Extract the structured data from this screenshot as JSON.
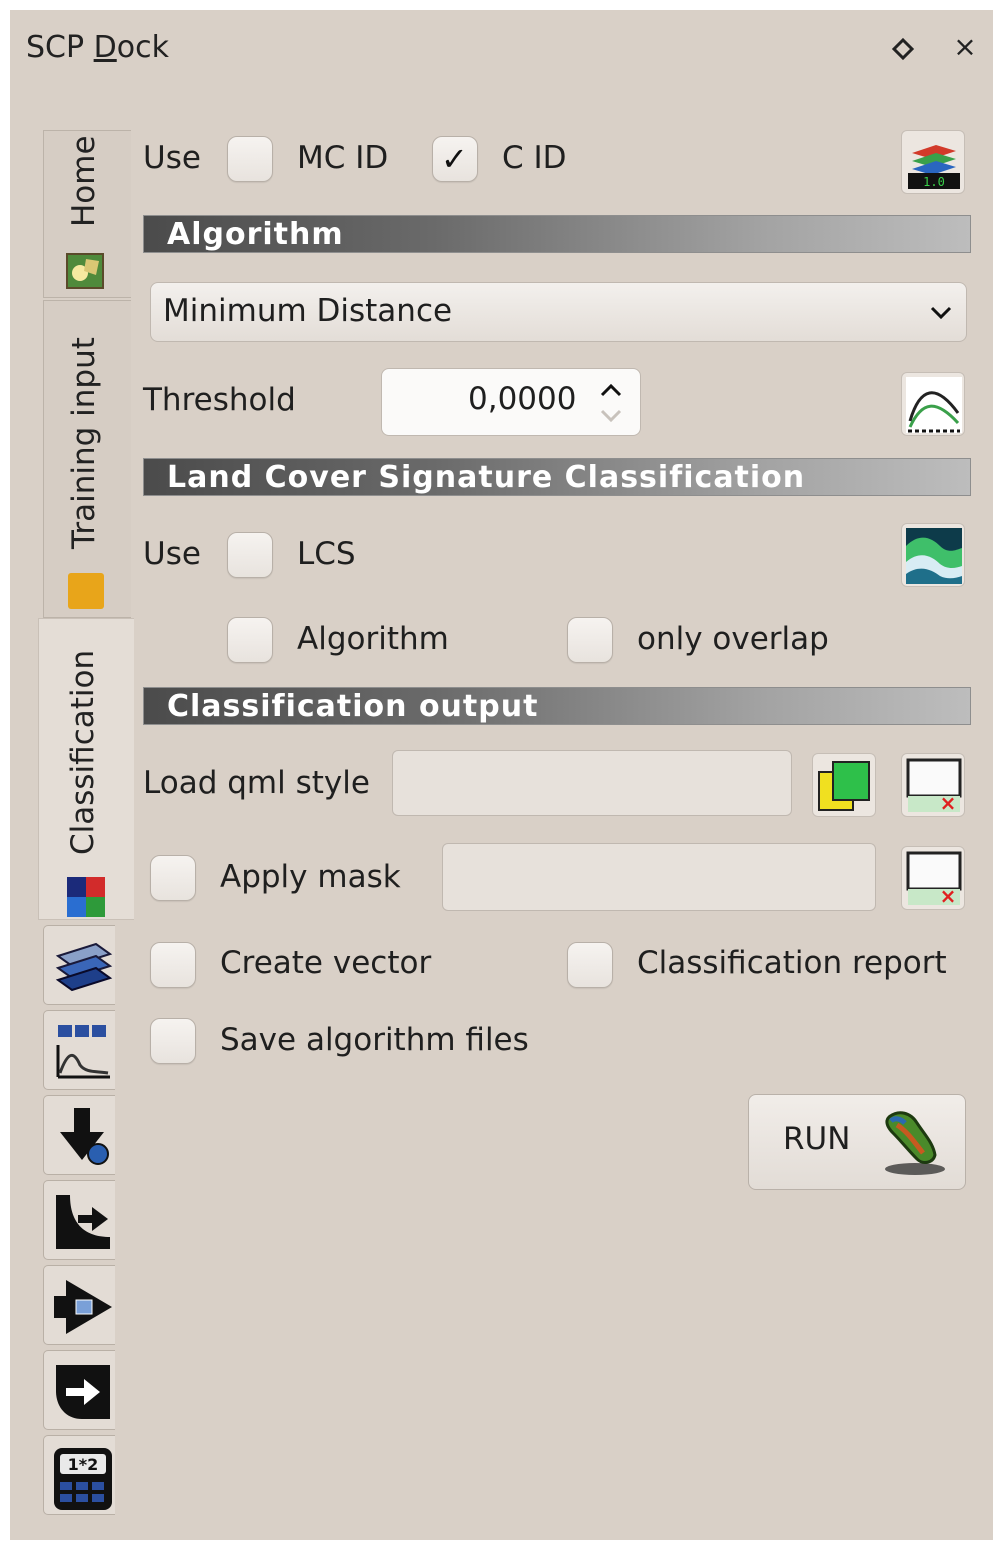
{
  "window": {
    "title_prefix": "SCP ",
    "title_underlined": "D",
    "title_suffix": "ock",
    "close_glyph": "×"
  },
  "tabs": [
    {
      "label": "Home",
      "icon": "home-icon"
    },
    {
      "label": "Training input",
      "icon": "training-input-icon"
    },
    {
      "label": "Classification",
      "icon": "classification-icon",
      "active": true
    }
  ],
  "tool_buttons": [
    "band-set-icon",
    "spectral-plot-icon",
    "download-icon",
    "preprocessing-icon",
    "postprocessing-icon",
    "band-processing-icon",
    "band-calc-icon"
  ],
  "use_row": {
    "use_label": "Use",
    "mc_id_label": "MC ID",
    "mc_id_checked": false,
    "c_id_label": "C ID",
    "c_id_checked": true
  },
  "algorithm": {
    "header": "Algorithm",
    "selected": "Minimum Distance",
    "threshold_label": "Threshold",
    "threshold_value": "0,0000"
  },
  "lcs": {
    "header": "Land Cover Signature Classification",
    "use_label": "Use",
    "lcs_label": "LCS",
    "algorithm_label": "Algorithm",
    "only_overlap_label": "only overlap"
  },
  "output": {
    "header": "Classification output",
    "load_qml_label": "Load qml style",
    "load_qml_value": "",
    "apply_mask_label": "Apply mask",
    "apply_mask_value": "",
    "create_vector_label": "Create vector",
    "classification_report_label": "Classification report",
    "save_algorithm_files_label": "Save algorithm files",
    "run_label": "RUN"
  },
  "colors": {
    "dock_bg": "#d9d0c7",
    "section_dark": "#4b4b4b",
    "section_light": "#bdbdbd"
  }
}
